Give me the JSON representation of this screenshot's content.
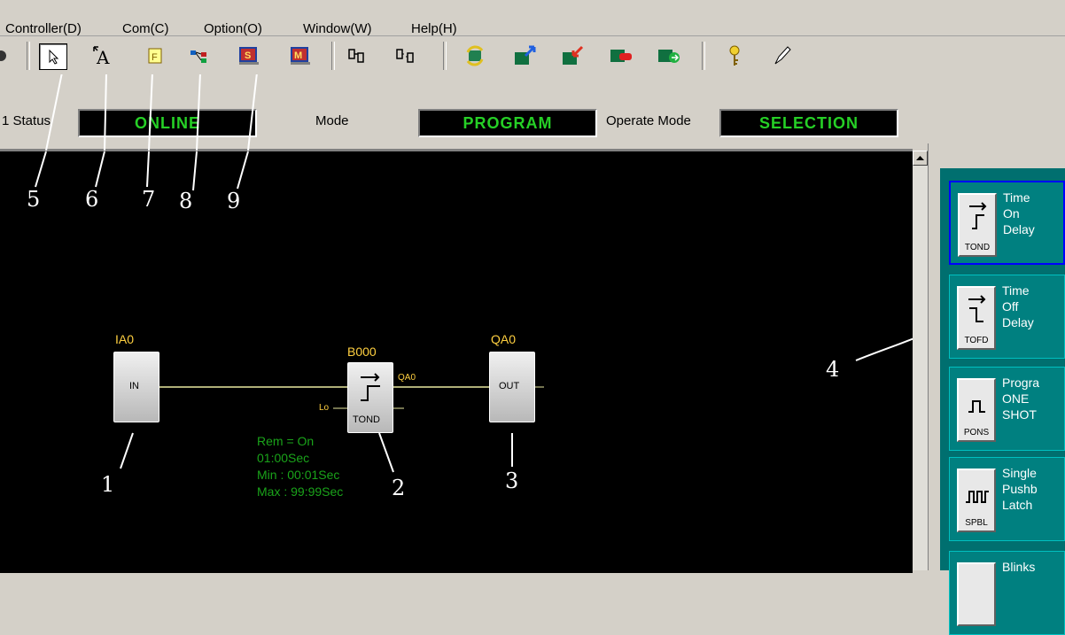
{
  "menu": {
    "items": [
      "Controller(D)",
      "Com(C)",
      "Option(O)",
      "Window(W)",
      "Help(H)"
    ]
  },
  "toolbar": {
    "icons": [
      "partial-icon",
      "pointer-icon",
      "text-icon",
      "function-icon",
      "connect-icon",
      "s-block-icon",
      "m-block-icon",
      "link-icon",
      "unlink-icon",
      "refresh-icon",
      "upload-icon",
      "download-icon",
      "stop-icon",
      "run-icon",
      "key-icon",
      "pen-icon"
    ]
  },
  "status": {
    "status_label": "1 Status",
    "status_value": "ONLINE",
    "mode_label": "Mode",
    "mode_value": "PROGRAM",
    "operate_label": "Operate Mode",
    "operate_value": "SELECTION"
  },
  "diagram": {
    "input": {
      "name": "IA0",
      "text": "IN"
    },
    "timer": {
      "name": "B000",
      "text": "TOND",
      "out_pin": "QA0",
      "lo_pin": "Lo"
    },
    "output": {
      "name": "QA0",
      "text": "OUT"
    },
    "params": [
      "Rem = On",
      "01:00Sec",
      "Min : 00:01Sec",
      "Max : 99:99Sec"
    ]
  },
  "callouts": [
    "1",
    "2",
    "3",
    "4",
    "5",
    "6",
    "7",
    "8",
    "9"
  ],
  "palette": [
    {
      "tag": "TOND",
      "text": "Time\nOn\nDelay"
    },
    {
      "tag": "TOFD",
      "text": "Time\nOff\nDelay"
    },
    {
      "tag": "PONS",
      "text": "Progra\nONE\nSHOT"
    },
    {
      "tag": "SPBL",
      "text": "Single\nPushb\nLatch"
    },
    {
      "tag": "",
      "text": "Blinks"
    }
  ],
  "colors": {
    "canvas": "#000000",
    "status_text": "#26d026",
    "palette_bg": "#008080"
  }
}
